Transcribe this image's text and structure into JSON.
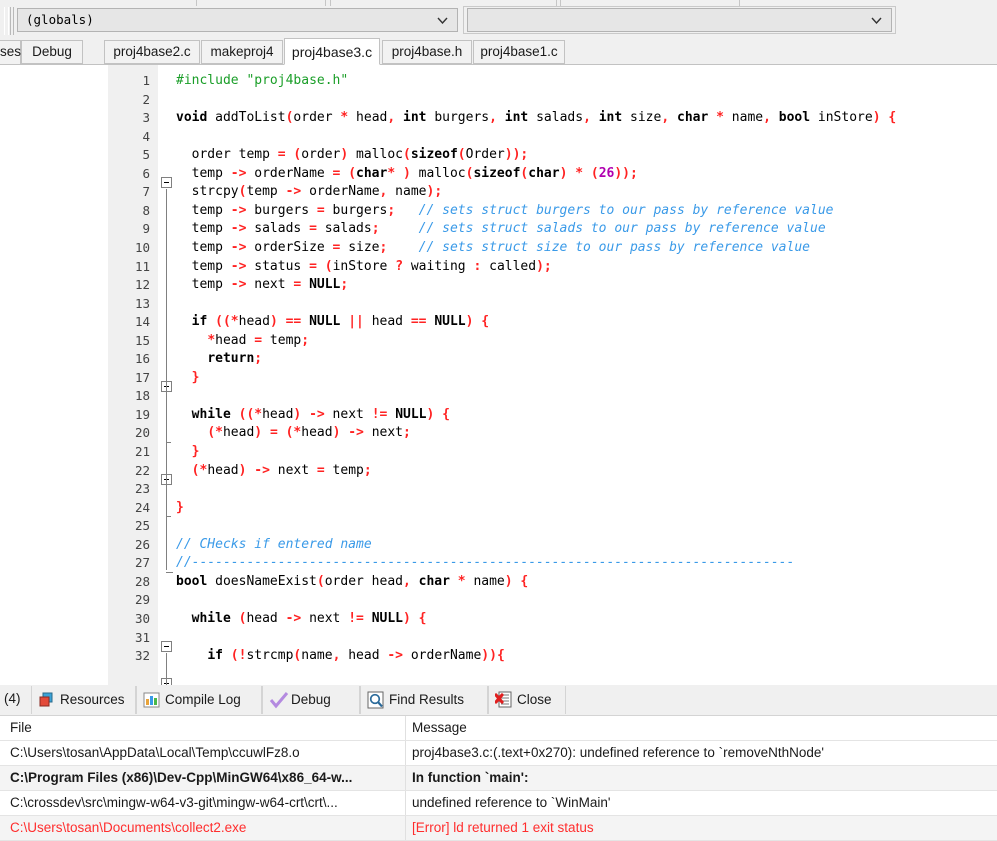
{
  "combo": {
    "scope_value": "(globals)",
    "member_value": "",
    "arrow_icon": "chevron-down-icon"
  },
  "tabbar": {
    "left_partial": "ses",
    "debug_tab": "Debug",
    "file_tabs": [
      {
        "label": "proj4base2.c",
        "active": false
      },
      {
        "label": "makeproj4",
        "active": false
      },
      {
        "label": "proj4base3.c",
        "active": true
      },
      {
        "label": "proj4base.h",
        "active": false
      },
      {
        "label": "proj4base1.c",
        "active": false
      }
    ]
  },
  "editor": {
    "lines": [
      {
        "n": 1,
        "segs": [
          {
            "t": "#include ",
            "c": "pre"
          },
          {
            "t": "\"proj4base.h\"",
            "c": "s"
          }
        ]
      },
      {
        "n": 2,
        "segs": []
      },
      {
        "n": 3,
        "segs": [
          {
            "t": "void",
            "c": "k"
          },
          {
            "t": " addToList",
            "c": "id"
          },
          {
            "t": "(",
            "c": "p"
          },
          {
            "t": "order ",
            "c": "id"
          },
          {
            "t": "*",
            "c": "p"
          },
          {
            "t": " head",
            "c": "id"
          },
          {
            "t": ",",
            "c": "p"
          },
          {
            "t": " ",
            "c": "id"
          },
          {
            "t": "int",
            "c": "k"
          },
          {
            "t": " burgers",
            "c": "id"
          },
          {
            "t": ",",
            "c": "p"
          },
          {
            "t": " ",
            "c": "id"
          },
          {
            "t": "int",
            "c": "k"
          },
          {
            "t": " salads",
            "c": "id"
          },
          {
            "t": ",",
            "c": "p"
          },
          {
            "t": " ",
            "c": "id"
          },
          {
            "t": "int",
            "c": "k"
          },
          {
            "t": " size",
            "c": "id"
          },
          {
            "t": ",",
            "c": "p"
          },
          {
            "t": " ",
            "c": "id"
          },
          {
            "t": "char",
            "c": "k"
          },
          {
            "t": " ",
            "c": "id"
          },
          {
            "t": "*",
            "c": "p"
          },
          {
            "t": " name",
            "c": "id"
          },
          {
            "t": ",",
            "c": "p"
          },
          {
            "t": " ",
            "c": "id"
          },
          {
            "t": "bool",
            "c": "k"
          },
          {
            "t": " inStore",
            "c": "id"
          },
          {
            "t": ") {",
            "c": "p"
          }
        ]
      },
      {
        "n": 4,
        "segs": []
      },
      {
        "n": 5,
        "segs": [
          {
            "t": "  order temp ",
            "c": "id"
          },
          {
            "t": "=",
            "c": "p"
          },
          {
            "t": " ",
            "c": "id"
          },
          {
            "t": "(",
            "c": "p"
          },
          {
            "t": "order",
            "c": "id"
          },
          {
            "t": ")",
            "c": "p"
          },
          {
            "t": " malloc",
            "c": "id"
          },
          {
            "t": "(",
            "c": "p"
          },
          {
            "t": "sizeof",
            "c": "k"
          },
          {
            "t": "(",
            "c": "p"
          },
          {
            "t": "Order",
            "c": "id"
          },
          {
            "t": "));",
            "c": "p"
          }
        ]
      },
      {
        "n": 6,
        "segs": [
          {
            "t": "  temp ",
            "c": "id"
          },
          {
            "t": "->",
            "c": "p"
          },
          {
            "t": " orderName ",
            "c": "id"
          },
          {
            "t": "=",
            "c": "p"
          },
          {
            "t": " ",
            "c": "id"
          },
          {
            "t": "(",
            "c": "p"
          },
          {
            "t": "char",
            "c": "k"
          },
          {
            "t": "*",
            "c": "p"
          },
          {
            "t": " ",
            "c": "id"
          },
          {
            "t": ")",
            "c": "p"
          },
          {
            "t": " malloc",
            "c": "id"
          },
          {
            "t": "(",
            "c": "p"
          },
          {
            "t": "sizeof",
            "c": "k"
          },
          {
            "t": "(",
            "c": "p"
          },
          {
            "t": "char",
            "c": "k"
          },
          {
            "t": ")",
            "c": "p"
          },
          {
            "t": " ",
            "c": "id"
          },
          {
            "t": "*",
            "c": "p"
          },
          {
            "t": " ",
            "c": "id"
          },
          {
            "t": "(",
            "c": "p"
          },
          {
            "t": "26",
            "c": "n"
          },
          {
            "t": "));",
            "c": "p"
          }
        ]
      },
      {
        "n": 7,
        "segs": [
          {
            "t": "  strcpy",
            "c": "id"
          },
          {
            "t": "(",
            "c": "p"
          },
          {
            "t": "temp ",
            "c": "id"
          },
          {
            "t": "->",
            "c": "p"
          },
          {
            "t": " orderName",
            "c": "id"
          },
          {
            "t": ",",
            "c": "p"
          },
          {
            "t": " name",
            "c": "id"
          },
          {
            "t": ");",
            "c": "p"
          }
        ]
      },
      {
        "n": 8,
        "segs": [
          {
            "t": "  temp ",
            "c": "id"
          },
          {
            "t": "->",
            "c": "p"
          },
          {
            "t": " burgers ",
            "c": "id"
          },
          {
            "t": "=",
            "c": "p"
          },
          {
            "t": " burgers",
            "c": "id"
          },
          {
            "t": ";",
            "c": "p"
          },
          {
            "t": "   ",
            "c": "id"
          },
          {
            "t": "// sets struct burgers to our pass by reference value",
            "c": "c"
          }
        ]
      },
      {
        "n": 9,
        "segs": [
          {
            "t": "  temp ",
            "c": "id"
          },
          {
            "t": "->",
            "c": "p"
          },
          {
            "t": " salads ",
            "c": "id"
          },
          {
            "t": "=",
            "c": "p"
          },
          {
            "t": " salads",
            "c": "id"
          },
          {
            "t": ";",
            "c": "p"
          },
          {
            "t": "     ",
            "c": "id"
          },
          {
            "t": "// sets struct salads to our pass by reference value",
            "c": "c"
          }
        ]
      },
      {
        "n": 10,
        "segs": [
          {
            "t": "  temp ",
            "c": "id"
          },
          {
            "t": "->",
            "c": "p"
          },
          {
            "t": " orderSize ",
            "c": "id"
          },
          {
            "t": "=",
            "c": "p"
          },
          {
            "t": " size",
            "c": "id"
          },
          {
            "t": ";",
            "c": "p"
          },
          {
            "t": "    ",
            "c": "id"
          },
          {
            "t": "// sets struct size to our pass by reference value",
            "c": "c"
          }
        ]
      },
      {
        "n": 11,
        "segs": [
          {
            "t": "  temp ",
            "c": "id"
          },
          {
            "t": "->",
            "c": "p"
          },
          {
            "t": " status ",
            "c": "id"
          },
          {
            "t": "=",
            "c": "p"
          },
          {
            "t": " ",
            "c": "id"
          },
          {
            "t": "(",
            "c": "p"
          },
          {
            "t": "inStore ",
            "c": "id"
          },
          {
            "t": "?",
            "c": "p"
          },
          {
            "t": " waiting ",
            "c": "id"
          },
          {
            "t": ":",
            "c": "p"
          },
          {
            "t": " called",
            "c": "id"
          },
          {
            "t": ");",
            "c": "p"
          }
        ]
      },
      {
        "n": 12,
        "segs": [
          {
            "t": "  temp ",
            "c": "id"
          },
          {
            "t": "->",
            "c": "p"
          },
          {
            "t": " next ",
            "c": "id"
          },
          {
            "t": "=",
            "c": "p"
          },
          {
            "t": " ",
            "c": "id"
          },
          {
            "t": "NULL",
            "c": "k"
          },
          {
            "t": ";",
            "c": "p"
          }
        ]
      },
      {
        "n": 13,
        "segs": []
      },
      {
        "n": 14,
        "segs": [
          {
            "t": "  ",
            "c": "id"
          },
          {
            "t": "if",
            "c": "k"
          },
          {
            "t": " ",
            "c": "id"
          },
          {
            "t": "((*",
            "c": "p"
          },
          {
            "t": "head",
            "c": "id"
          },
          {
            "t": ")",
            "c": "p"
          },
          {
            "t": " ",
            "c": "id"
          },
          {
            "t": "==",
            "c": "p"
          },
          {
            "t": " ",
            "c": "id"
          },
          {
            "t": "NULL",
            "c": "k"
          },
          {
            "t": " ",
            "c": "id"
          },
          {
            "t": "||",
            "c": "p"
          },
          {
            "t": " head ",
            "c": "id"
          },
          {
            "t": "==",
            "c": "p"
          },
          {
            "t": " ",
            "c": "id"
          },
          {
            "t": "NULL",
            "c": "k"
          },
          {
            "t": ") {",
            "c": "p"
          }
        ]
      },
      {
        "n": 15,
        "segs": [
          {
            "t": "    ",
            "c": "id"
          },
          {
            "t": "*",
            "c": "p"
          },
          {
            "t": "head ",
            "c": "id"
          },
          {
            "t": "=",
            "c": "p"
          },
          {
            "t": " temp",
            "c": "id"
          },
          {
            "t": ";",
            "c": "p"
          }
        ]
      },
      {
        "n": 16,
        "segs": [
          {
            "t": "    ",
            "c": "id"
          },
          {
            "t": "return",
            "c": "k"
          },
          {
            "t": ";",
            "c": "p"
          }
        ]
      },
      {
        "n": 17,
        "segs": [
          {
            "t": "  ",
            "c": "id"
          },
          {
            "t": "}",
            "c": "p"
          }
        ]
      },
      {
        "n": 18,
        "segs": []
      },
      {
        "n": 19,
        "segs": [
          {
            "t": "  ",
            "c": "id"
          },
          {
            "t": "while",
            "c": "k"
          },
          {
            "t": " ",
            "c": "id"
          },
          {
            "t": "((*",
            "c": "p"
          },
          {
            "t": "head",
            "c": "id"
          },
          {
            "t": ")",
            "c": "p"
          },
          {
            "t": " ",
            "c": "id"
          },
          {
            "t": "->",
            "c": "p"
          },
          {
            "t": " next ",
            "c": "id"
          },
          {
            "t": "!=",
            "c": "p"
          },
          {
            "t": " ",
            "c": "id"
          },
          {
            "t": "NULL",
            "c": "k"
          },
          {
            "t": ") {",
            "c": "p"
          }
        ]
      },
      {
        "n": 20,
        "segs": [
          {
            "t": "    ",
            "c": "id"
          },
          {
            "t": "(*",
            "c": "p"
          },
          {
            "t": "head",
            "c": "id"
          },
          {
            "t": ")",
            "c": "p"
          },
          {
            "t": " ",
            "c": "id"
          },
          {
            "t": "=",
            "c": "p"
          },
          {
            "t": " ",
            "c": "id"
          },
          {
            "t": "(*",
            "c": "p"
          },
          {
            "t": "head",
            "c": "id"
          },
          {
            "t": ")",
            "c": "p"
          },
          {
            "t": " ",
            "c": "id"
          },
          {
            "t": "->",
            "c": "p"
          },
          {
            "t": " next",
            "c": "id"
          },
          {
            "t": ";",
            "c": "p"
          }
        ]
      },
      {
        "n": 21,
        "segs": [
          {
            "t": "  ",
            "c": "id"
          },
          {
            "t": "}",
            "c": "p"
          }
        ]
      },
      {
        "n": 22,
        "segs": [
          {
            "t": "  ",
            "c": "id"
          },
          {
            "t": "(*",
            "c": "p"
          },
          {
            "t": "head",
            "c": "id"
          },
          {
            "t": ")",
            "c": "p"
          },
          {
            "t": " ",
            "c": "id"
          },
          {
            "t": "->",
            "c": "p"
          },
          {
            "t": " next ",
            "c": "id"
          },
          {
            "t": "=",
            "c": "p"
          },
          {
            "t": " temp",
            "c": "id"
          },
          {
            "t": ";",
            "c": "p"
          }
        ]
      },
      {
        "n": 23,
        "segs": []
      },
      {
        "n": 24,
        "segs": [
          {
            "t": "}",
            "c": "p"
          }
        ]
      },
      {
        "n": 25,
        "segs": []
      },
      {
        "n": 26,
        "segs": [
          {
            "t": "// CHecks if entered name",
            "c": "c"
          }
        ]
      },
      {
        "n": 27,
        "segs": [
          {
            "t": "//-----------------------------------------------------------------------------",
            "c": "c"
          }
        ]
      },
      {
        "n": 28,
        "segs": [
          {
            "t": "bool",
            "c": "k"
          },
          {
            "t": " doesNameExist",
            "c": "id"
          },
          {
            "t": "(",
            "c": "p"
          },
          {
            "t": "order head",
            "c": "id"
          },
          {
            "t": ",",
            "c": "p"
          },
          {
            "t": " ",
            "c": "id"
          },
          {
            "t": "char",
            "c": "k"
          },
          {
            "t": " ",
            "c": "id"
          },
          {
            "t": "*",
            "c": "p"
          },
          {
            "t": " name",
            "c": "id"
          },
          {
            "t": ") {",
            "c": "p"
          }
        ]
      },
      {
        "n": 29,
        "segs": []
      },
      {
        "n": 30,
        "segs": [
          {
            "t": "  ",
            "c": "id"
          },
          {
            "t": "while",
            "c": "k"
          },
          {
            "t": " ",
            "c": "id"
          },
          {
            "t": "(",
            "c": "p"
          },
          {
            "t": "head ",
            "c": "id"
          },
          {
            "t": "->",
            "c": "p"
          },
          {
            "t": " next ",
            "c": "id"
          },
          {
            "t": "!=",
            "c": "p"
          },
          {
            "t": " ",
            "c": "id"
          },
          {
            "t": "NULL",
            "c": "k"
          },
          {
            "t": ") {",
            "c": "p"
          }
        ]
      },
      {
        "n": 31,
        "segs": []
      },
      {
        "n": 32,
        "segs": [
          {
            "t": "    ",
            "c": "id"
          },
          {
            "t": "if",
            "c": "k"
          },
          {
            "t": " ",
            "c": "id"
          },
          {
            "t": "(!",
            "c": "p"
          },
          {
            "t": "strcmp",
            "c": "id"
          },
          {
            "t": "(",
            "c": "p"
          },
          {
            "t": "name",
            "c": "id"
          },
          {
            "t": ",",
            "c": "p"
          },
          {
            "t": " head ",
            "c": "id"
          },
          {
            "t": "->",
            "c": "p"
          },
          {
            "t": " orderName",
            "c": "id"
          },
          {
            "t": ")){",
            "c": "p"
          }
        ]
      }
    ]
  },
  "bottom_panel": {
    "counter": "(4)",
    "tabs": [
      {
        "label": "Resources",
        "icon": "resources-icon"
      },
      {
        "label": "Compile Log",
        "icon": "compile-log-icon"
      },
      {
        "label": "Debug",
        "icon": "debug-check-icon"
      },
      {
        "label": "Find Results",
        "icon": "find-results-icon"
      },
      {
        "label": "Close",
        "icon": "close-icon"
      }
    ],
    "columns": [
      "File",
      "Message"
    ],
    "rows": [
      {
        "file": "C:\\Users\\tosan\\AppData\\Local\\Temp\\ccuwlFz8.o",
        "message": "proj4base3.c:(.text+0x270): undefined reference to `removeNthNode'",
        "bold": false,
        "error": false
      },
      {
        "file": "C:\\Program Files (x86)\\Dev-Cpp\\MinGW64\\x86_64-w...",
        "message": "In function `main':",
        "bold": true,
        "error": false
      },
      {
        "file": "C:\\crossdev\\src\\mingw-w64-v3-git\\mingw-w64-crt\\crt\\...",
        "message": "undefined reference to `WinMain'",
        "bold": false,
        "error": false
      },
      {
        "file": "C:\\Users\\tosan\\Documents\\collect2.exe",
        "message": "[Error] ld returned 1 exit status",
        "bold": false,
        "error": true
      }
    ]
  },
  "colors": {
    "keyword": "#000000",
    "punctuation": "#ff2222",
    "string": "#1a9e28",
    "comment": "#3a9ae8",
    "number": "#b000b0",
    "error": "#ff2d2d",
    "panel_bg": "#f0f0f0"
  }
}
